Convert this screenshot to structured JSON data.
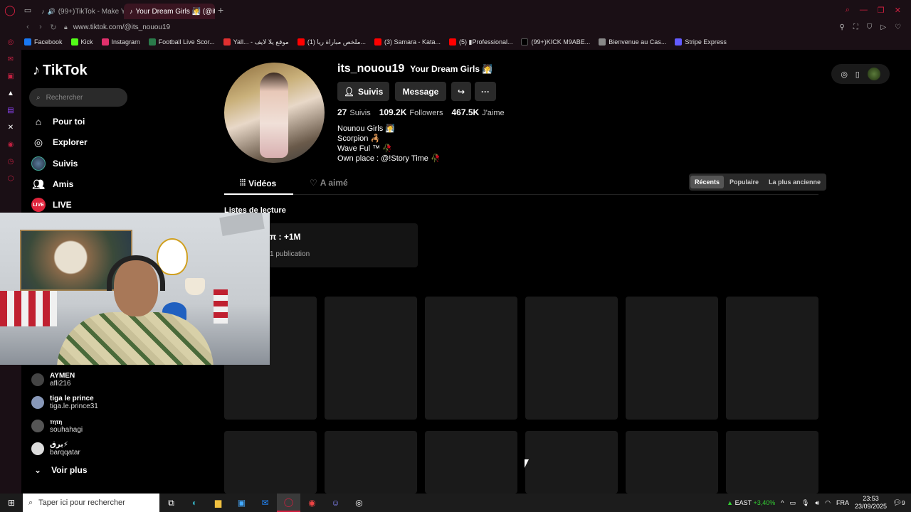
{
  "browser": {
    "tabs": [
      {
        "label": "(99+)TikTok - Make Y..."
      },
      {
        "label": "Your Dream Girls 🧖 (@it..."
      }
    ],
    "url": "www.tiktok.com/@its_nouou19",
    "bookmarks": [
      {
        "label": "Facebook",
        "color": "#1877f2"
      },
      {
        "label": "Kick",
        "color": "#53fc18"
      },
      {
        "label": "Instagram",
        "color": "#e1306c"
      },
      {
        "label": "Football Live Scor...",
        "color": "#2a7a4a"
      },
      {
        "label": "Yall... - موقع يلا لايف",
        "color": "#e03030"
      },
      {
        "label": "(1) ملخص مباراة ريا...",
        "color": "#ff0000"
      },
      {
        "label": "(3) Samara - Kata...",
        "color": "#ff0000"
      },
      {
        "label": "(5) ▮Professional...",
        "color": "#ff0000"
      },
      {
        "label": "(99+)KICK M9ABE...",
        "color": "#000000"
      },
      {
        "label": "Bienvenue au Cas...",
        "color": "#888888"
      },
      {
        "label": "Stripe Express",
        "color": "#635bff"
      }
    ]
  },
  "tiktok": {
    "logo": "TikTok",
    "search_placeholder": "Rechercher",
    "nav": {
      "for_you": "Pour toi",
      "explore": "Explorer",
      "following": "Suivis",
      "friends": "Amis",
      "live": "LIVE",
      "live_badge": "LIVE"
    },
    "following_accounts": [
      {
        "name": "AYMEN",
        "handle": "afli216"
      },
      {
        "name": "tiga le prince",
        "handle": "tiga.le.prince31"
      },
      {
        "name": "тητη",
        "handle": "souhahagi"
      },
      {
        "name": "برق⚡",
        "handle": "barqqatar"
      }
    ],
    "see_more": "Voir plus"
  },
  "profile": {
    "username": "its_nouou19",
    "nickname": "Your Dream Girls 🧖",
    "follow_button": "Suivis",
    "message_button": "Message",
    "stats": {
      "following_count": "27",
      "following_label": "Suivis",
      "followers_count": "109.2K",
      "followers_label": "Followers",
      "likes_count": "467.5K",
      "likes_label": "J'aime"
    },
    "bio": [
      "Nounou Girls 🧖",
      "Scorpion 🦂",
      "Wave Ful ™ 🥀",
      "Own place : @!Story Time 🥀"
    ],
    "tabs": {
      "videos": "Vidéos",
      "liked": "A aimé"
    },
    "sort": {
      "recent": "Récents",
      "popular": "Populaire",
      "oldest": "La plus ancienne"
    },
    "playlists_title": "Listes de lecture",
    "playlist": {
      "name": "π : +1M",
      "count": "1 publication"
    }
  },
  "taskbar": {
    "search_placeholder": "Taper ici pour rechercher",
    "stock_name": "EAST",
    "stock_change": "+3,40%",
    "language": "FRA",
    "time": "23:53",
    "date": "23/09/2025",
    "notif_count": "9"
  }
}
